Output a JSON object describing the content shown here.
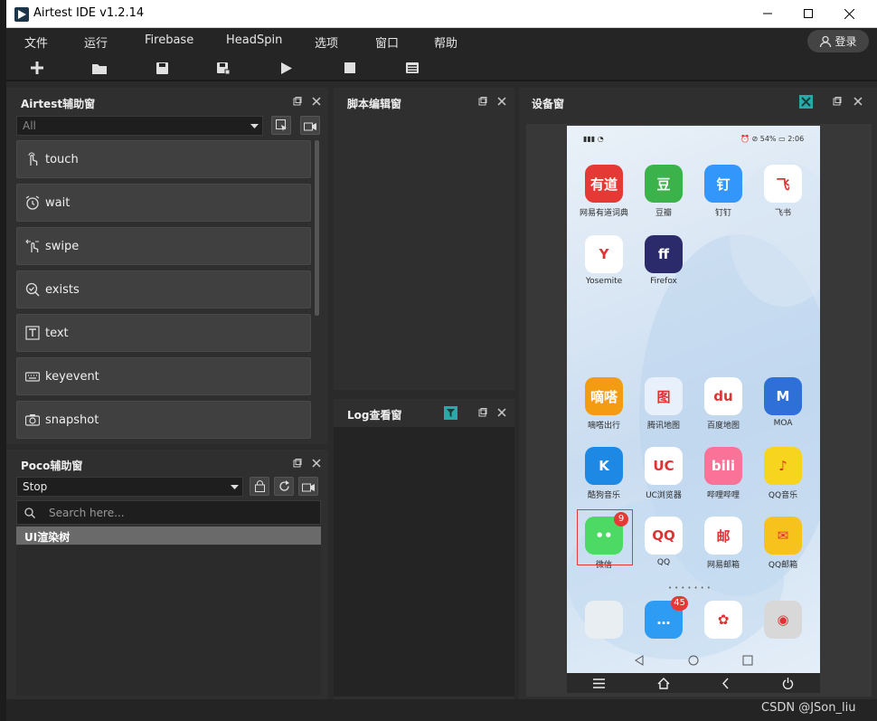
{
  "window": {
    "title": "Airtest IDE v1.2.14"
  },
  "menubar": {
    "items": [
      "文件",
      "运行",
      "Firebase",
      "HeadSpin",
      "选项",
      "窗口",
      "帮助"
    ],
    "login": "登录"
  },
  "toolbar": {
    "icons": [
      "plus-icon",
      "open-folder-icon",
      "save-icon",
      "save-as-icon",
      "play-icon",
      "stop-icon",
      "log-icon"
    ]
  },
  "airtest_panel": {
    "title": "Airtest辅助窗",
    "filter": "All",
    "apis": [
      "touch",
      "wait",
      "swipe",
      "exists",
      "text",
      "keyevent",
      "snapshot"
    ]
  },
  "poco_panel": {
    "title": "Poco辅助窗",
    "mode": "Stop",
    "search_placeholder": "Search here...",
    "tree_root": "UI渲染树"
  },
  "script_panel": {
    "title": "脚本编辑窗"
  },
  "log_panel": {
    "title": "Log查看窗"
  },
  "device_panel": {
    "title": "设备窗"
  },
  "phone": {
    "status_battery": "54%",
    "status_time": "2:06",
    "apps_top": [
      {
        "label": "网易有道词典",
        "glyph": "有道",
        "color": "#e53935"
      },
      {
        "label": "豆瓣",
        "glyph": "豆",
        "color": "#3cb34a"
      },
      {
        "label": "钉钉",
        "glyph": "钉",
        "color": "#3296fa"
      },
      {
        "label": "飞书",
        "glyph": "飞",
        "color": "#ffffff"
      },
      {
        "label": "Yosemite",
        "glyph": "Y",
        "color": "#ffffff"
      },
      {
        "label": "Firefox",
        "glyph": "ff",
        "color": "#2b2a6a"
      }
    ],
    "apps_mid": [
      {
        "label": "嘀嗒出行",
        "glyph": "嘀嗒",
        "color": "#f39c12"
      },
      {
        "label": "腾讯地图",
        "glyph": "图",
        "color": "#e8f1fb"
      },
      {
        "label": "百度地图",
        "glyph": "du",
        "color": "#ffffff"
      },
      {
        "label": "MOA",
        "glyph": "M",
        "color": "#2f6fd8"
      },
      {
        "label": "酷狗音乐",
        "glyph": "K",
        "color": "#1e88e5"
      },
      {
        "label": "UC浏览器",
        "glyph": "UC",
        "color": "#ffffff"
      },
      {
        "label": "哔哩哔哩",
        "glyph": "bili",
        "color": "#fb7299"
      },
      {
        "label": "QQ音乐",
        "glyph": "♪",
        "color": "#f7d51f"
      },
      {
        "label": "微信",
        "glyph": "••",
        "color": "#4cd964",
        "badge": "9"
      },
      {
        "label": "QQ",
        "glyph": "QQ",
        "color": "#ffffff"
      },
      {
        "label": "网易邮箱",
        "glyph": "邮",
        "color": "#ffffff"
      },
      {
        "label": "QQ邮箱",
        "glyph": "✉",
        "color": "#f7c21b"
      }
    ],
    "dock": [
      {
        "glyph": "",
        "color": "#e9eef3"
      },
      {
        "glyph": "…",
        "color": "#2f9cf3",
        "badge": "45"
      },
      {
        "glyph": "✿",
        "color": "#ffffff"
      },
      {
        "glyph": "◉",
        "color": "#d8d8d8"
      }
    ]
  },
  "watermark": "CSDN @JSon_liu",
  "colors": {
    "accent_teal": "#2aa7a7",
    "selection_red": "#e53935"
  }
}
